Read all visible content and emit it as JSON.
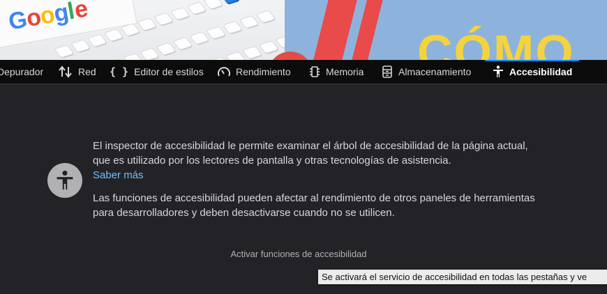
{
  "page": {
    "hero_word": "CÓMO"
  },
  "toolbar": {
    "tabs": [
      {
        "label": "Depurador",
        "icon": "debugger-icon"
      },
      {
        "label": "Red",
        "icon": "network-arrows-icon"
      },
      {
        "label": "Editor de estilos",
        "icon": "braces-icon"
      },
      {
        "label": "Rendimiento",
        "icon": "gauge-icon"
      },
      {
        "label": "Memoria",
        "icon": "memory-chip-icon"
      },
      {
        "label": "Almacenamiento",
        "icon": "storage-icon"
      },
      {
        "label": "Accesibilidad",
        "icon": "accessibility-icon",
        "selected": true
      }
    ]
  },
  "panel": {
    "description_1": "El inspector de accesibilidad le permite examinar el árbol de accesibilidad de la página actual, que es utilizado por los lectores de pantalla y otras tecnologías de asistencia.",
    "learn_more": "Saber más",
    "description_2": "Las funciones de accesibilidad pueden afectar al rendimiento de otros paneles de herramientas para desarrolladores y deben desactivarse cuando no se utilicen.",
    "enable_button": "Activar funciones de accesibilidad",
    "tooltip": "Se activará el servicio de accesibilidad en todas las pestañas y ve"
  },
  "colors": {
    "toolbar_bg": "#0c0c0d",
    "panel_bg": "#232327",
    "accent": "#0a84ff",
    "link": "#75bfff"
  }
}
